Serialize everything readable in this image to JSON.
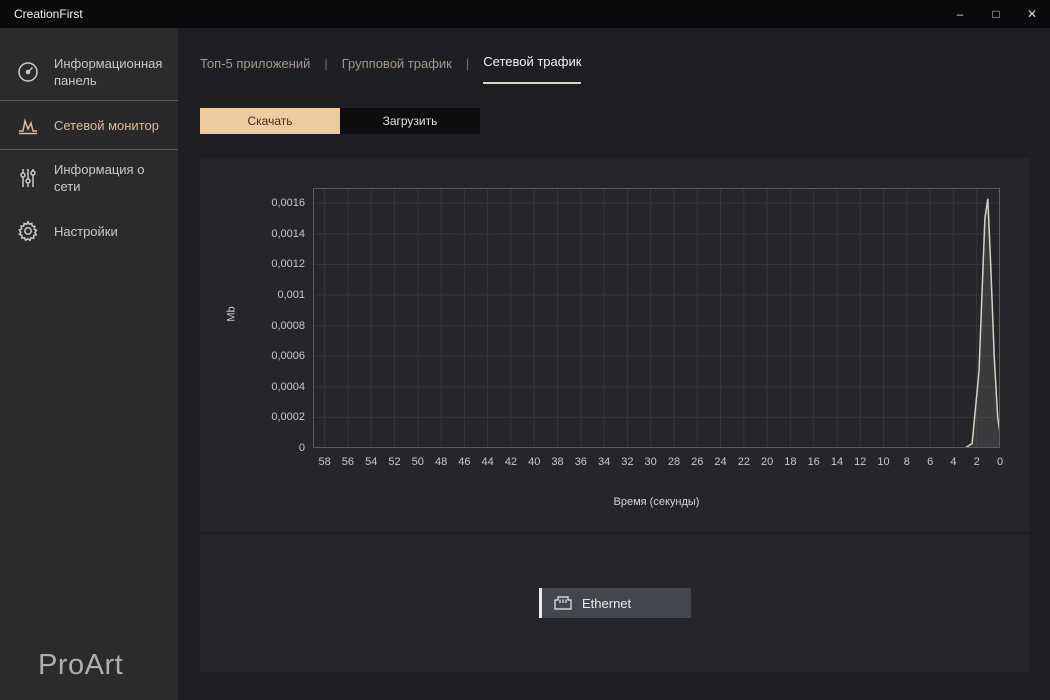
{
  "window": {
    "title": "CreationFirst",
    "controls": {
      "minimize": "–",
      "maximize": "□",
      "close": "✕"
    }
  },
  "sidebar": {
    "items": [
      {
        "label": "Информационная панель",
        "active": false
      },
      {
        "label": "Сетевой монитор",
        "active": true
      },
      {
        "label": "Информация о сети",
        "active": false
      },
      {
        "label": "Настройки",
        "active": false
      }
    ],
    "logo": "ProArt"
  },
  "tabs": {
    "separator": "|",
    "items": [
      {
        "label": "Топ-5 приложений",
        "active": false
      },
      {
        "label": "Групповой трафик",
        "active": false
      },
      {
        "label": "Сетевой трафик",
        "active": true
      }
    ]
  },
  "toggles": {
    "download": "Скачать",
    "upload": "Загрузить",
    "selected": "Скачать"
  },
  "adapter": {
    "label": "Ethernet"
  },
  "colors": {
    "accent": "#eecb9e",
    "chart_line": "#d8d1c6",
    "active_text": "#dcbd96"
  },
  "chart_data": {
    "type": "line",
    "title": "",
    "xlabel": "Время (секунды)",
    "ylabel": "Mb",
    "xlim": [
      59,
      0
    ],
    "ylim": [
      0,
      0.0017
    ],
    "grid": true,
    "legend": "none",
    "x_ticks": [
      58,
      56,
      54,
      52,
      50,
      48,
      46,
      44,
      42,
      40,
      38,
      36,
      34,
      32,
      30,
      28,
      26,
      24,
      22,
      20,
      18,
      16,
      14,
      12,
      10,
      8,
      6,
      4,
      2,
      0
    ],
    "y_ticks": [
      {
        "v": 0.0016,
        "label": "0,0016"
      },
      {
        "v": 0.0014,
        "label": "0,0014"
      },
      {
        "v": 0.0012,
        "label": "0,0012"
      },
      {
        "v": 0.001,
        "label": "0,001"
      },
      {
        "v": 0.0008,
        "label": "0,0008"
      },
      {
        "v": 0.0006,
        "label": "0,0006"
      },
      {
        "v": 0.0004,
        "label": "0,0004"
      },
      {
        "v": 0.0002,
        "label": "0,0002"
      },
      {
        "v": 0,
        "label": "0"
      }
    ],
    "series": [
      {
        "name": "Скачать",
        "points": [
          [
            59,
            0
          ],
          [
            3,
            0
          ],
          [
            2.4,
            3e-05
          ],
          [
            1.8,
            0.0005
          ],
          [
            1.3,
            0.0015
          ],
          [
            1.05,
            0.00163
          ],
          [
            0.8,
            0.0012
          ],
          [
            0.5,
            0.0006
          ],
          [
            0.2,
            0.0002
          ],
          [
            0,
            0.0001
          ]
        ]
      }
    ]
  }
}
